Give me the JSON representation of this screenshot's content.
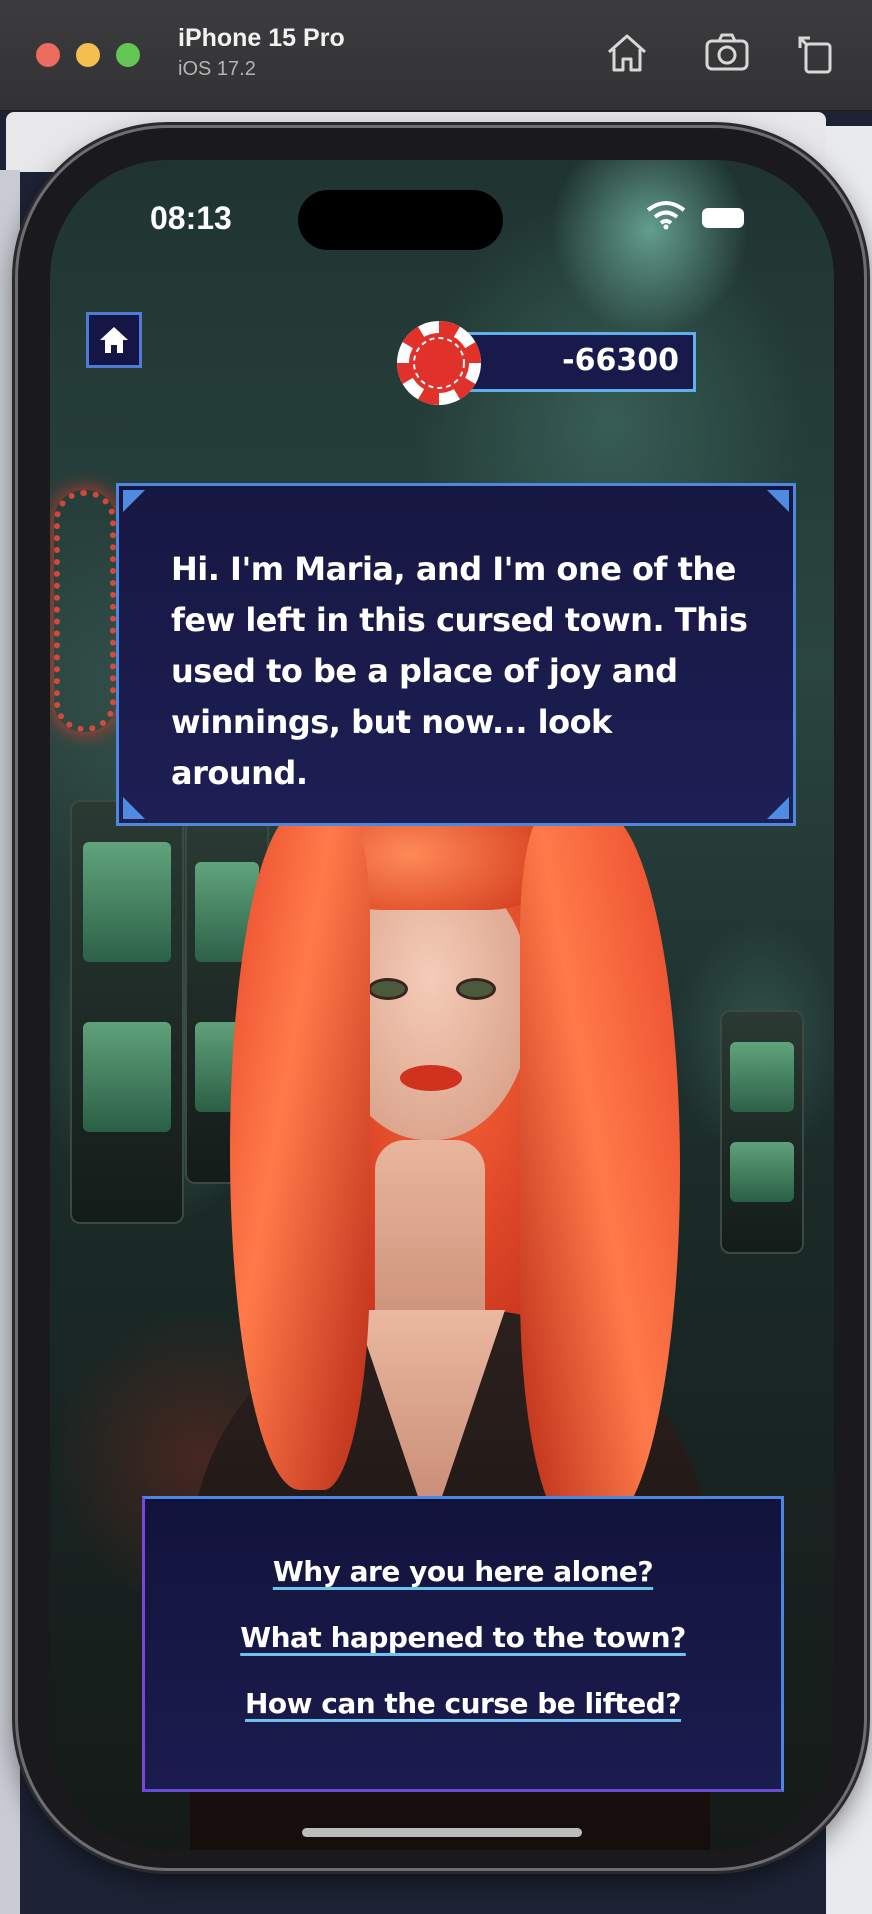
{
  "simulator": {
    "device_name": "iPhone 15 Pro",
    "os_version": "iOS 17.2",
    "toolbar_icons": [
      "home-icon",
      "screenshot-icon",
      "rotate-icon"
    ]
  },
  "status_bar": {
    "time": "08:13",
    "icons": [
      "wifi-icon",
      "battery-icon"
    ]
  },
  "hud": {
    "home_icon": "home-icon",
    "chip_icon": "casino-chip-icon",
    "chip_balance": "-66300"
  },
  "dialogue": {
    "text": "Hi. I'm Maria, and I'm one of the few left in this cursed town. This used to be a place of joy and winnings, but now... look around."
  },
  "choices": [
    "Why are you here alone?",
    "What happened to the town?",
    "How can the curse be lifted?"
  ],
  "colors": {
    "panel_bg": "#171a4a",
    "panel_border": "#4f86de",
    "chip_red": "#e0322a",
    "underline": "#6fc2f0"
  }
}
